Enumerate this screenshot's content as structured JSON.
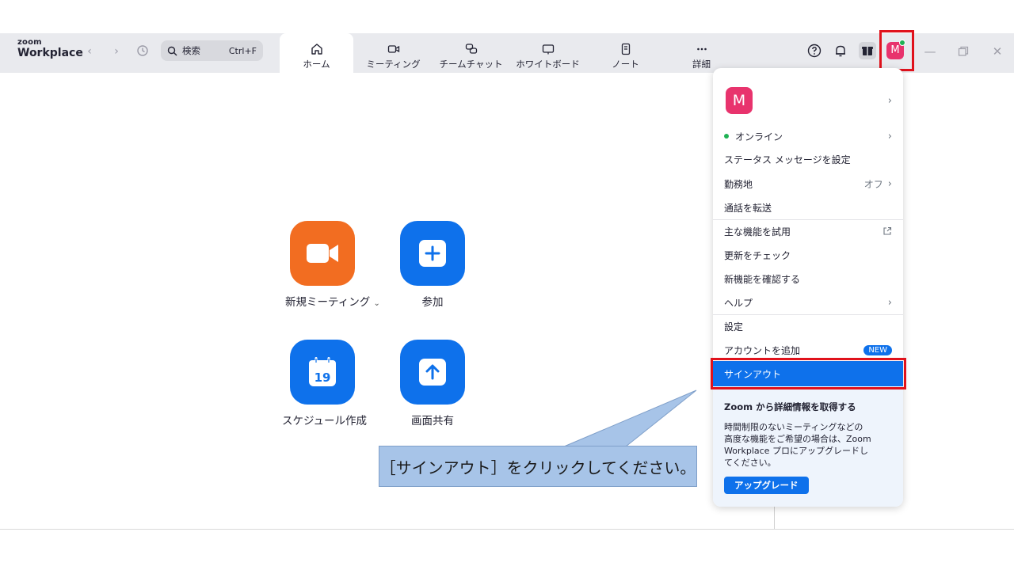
{
  "logo": {
    "line1": "zoom",
    "line2": "Workplace"
  },
  "search": {
    "label": "検索",
    "shortcut": "Ctrl+F"
  },
  "tabs": [
    {
      "label": "ホーム",
      "active": true
    },
    {
      "label": "ミーティング"
    },
    {
      "label": "チームチャット"
    },
    {
      "label": "ホワイトボード"
    },
    {
      "label": "ノート"
    },
    {
      "label": "詳細"
    }
  ],
  "avatar": {
    "initial": "M",
    "color": "#e8336d"
  },
  "home": {
    "new_meeting": "新規ミーティング",
    "join": "参加",
    "schedule": "スケジュール作成",
    "calendar_day": "19",
    "share_screen": "画面共有"
  },
  "menu": {
    "status": "オンライン",
    "set_status_message": "ステータス メッセージを設定",
    "work_location": "勤務地",
    "work_location_value": "オフ",
    "forward_calls": "通話を転送",
    "try_features": "主な機能を試用",
    "check_updates": "更新をチェック",
    "whats_new": "新機能を確認する",
    "help": "ヘルプ",
    "settings": "設定",
    "add_account": "アカウントを追加",
    "new_badge": "NEW",
    "sign_out": "サインアウト",
    "promo_title": "Zoom から詳細情報を取得する",
    "promo_body": "時間制限のないミーティングなどの高度な機能をご希望の場合は、Zoom Workplace プロにアップグレードしてください。",
    "promo_button": "アップグレード"
  },
  "callout": {
    "text": "［サインアウト］をクリックしてください。"
  },
  "colors": {
    "accent": "#0e71eb",
    "orange": "#f26d21",
    "highlight": "#e0121c"
  }
}
